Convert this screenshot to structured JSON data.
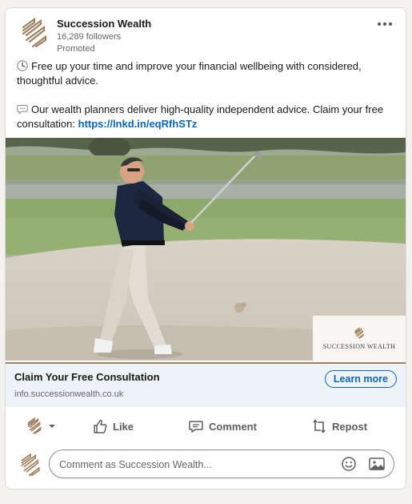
{
  "post": {
    "company_name": "Succession Wealth",
    "followers": "16,289 followers",
    "promoted": "Promoted",
    "text1": "Free up your time and improve your financial wellbeing with considered, thoughtful advice.",
    "text2": "Our wealth planners deliver high-quality independent advice. Claim your free consultation:",
    "link": "https://lnkd.in/eqRfhSTz",
    "icons": [
      "clock-icon",
      "speech-bubble-icon",
      "more-icon"
    ]
  },
  "hero": {
    "brand_text": "SUCCESSION WEALTH"
  },
  "cta": {
    "title": "Claim Your Free Consultation",
    "url": "info.successionwealth.co.uk",
    "button": "Learn more"
  },
  "actions": {
    "like": "Like",
    "comment": "Comment",
    "repost": "Repost"
  },
  "comment": {
    "placeholder": "Comment as Succession Wealth..."
  },
  "colors": {
    "brand": "#a08060",
    "link": "#0a66c2",
    "cta_bg": "#eef3f8"
  }
}
